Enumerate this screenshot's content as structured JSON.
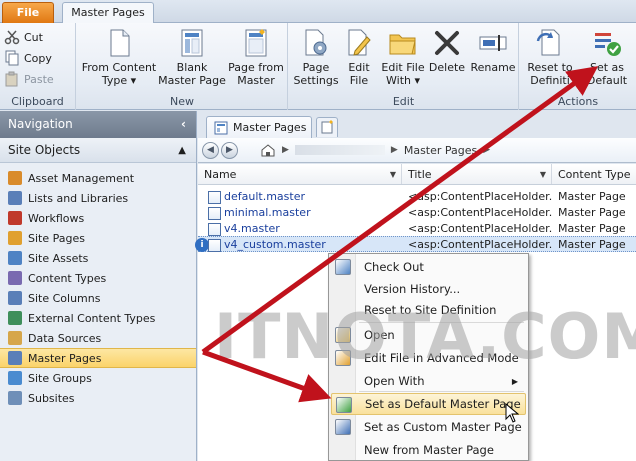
{
  "ribbon": {
    "tabs": [
      {
        "label": "File"
      },
      {
        "label": "Master Pages"
      }
    ],
    "clipboard": {
      "label": "Clipboard",
      "cut": "Cut",
      "copy": "Copy",
      "paste": "Paste"
    },
    "new_group": {
      "label": "New",
      "from_content_type": [
        "From Content",
        "Type ▾"
      ],
      "blank_master": [
        "Blank",
        "Master Page"
      ],
      "page_from_master": [
        "Page from",
        "Master"
      ]
    },
    "edit_group": {
      "label": "Edit",
      "page_settings": [
        "Page",
        "Settings"
      ],
      "edit_file": [
        "Edit",
        "File"
      ],
      "edit_file_with": [
        "Edit File",
        "With ▾"
      ],
      "delete": "Delete",
      "rename": "Rename"
    },
    "actions_group": {
      "label": "Actions",
      "reset": [
        "Reset to",
        "Definiti"
      ],
      "set_default": [
        "Set as",
        "Default"
      ]
    }
  },
  "navigation": {
    "title": "Navigation",
    "section": "Site Objects",
    "items": [
      {
        "label": "Asset Management",
        "icon": "asset-icon",
        "color": "#d98b2b"
      },
      {
        "label": "Lists and Libraries",
        "icon": "list-icon",
        "color": "#5a7fb8"
      },
      {
        "label": "Workflows",
        "icon": "workflow-icon",
        "color": "#c0392b"
      },
      {
        "label": "Site Pages",
        "icon": "pages-icon",
        "color": "#e0a030"
      },
      {
        "label": "Site Assets",
        "icon": "assets-icon",
        "color": "#4f83c4"
      },
      {
        "label": "Content Types",
        "icon": "content-types-icon",
        "color": "#7a6ab0"
      },
      {
        "label": "Site Columns",
        "icon": "columns-icon",
        "color": "#5a7fb8"
      },
      {
        "label": "External Content Types",
        "icon": "external-icon",
        "color": "#3f8f5b"
      },
      {
        "label": "Data Sources",
        "icon": "data-sources-icon",
        "color": "#d6a64a"
      },
      {
        "label": "Master Pages",
        "icon": "master-pages-icon",
        "color": "#5a7fb8",
        "selected": true
      },
      {
        "label": "Site Groups",
        "icon": "groups-icon",
        "color": "#4a8bd0"
      },
      {
        "label": "Subsites",
        "icon": "subsites-icon",
        "color": "#6f8fb8"
      }
    ]
  },
  "document": {
    "tab_label": "Master Pages",
    "breadcrumb": "Master Pages",
    "columns": [
      "Name",
      "Title",
      "Content Type"
    ],
    "rows": [
      {
        "name": "default.master",
        "title": "<asp:ContentPlaceHolder...",
        "type": "Master Page"
      },
      {
        "name": "minimal.master",
        "title": "<asp:ContentPlaceHolder...",
        "type": "Master Page"
      },
      {
        "name": "v4.master",
        "title": "<asp:ContentPlaceHolder...",
        "type": "Master Page"
      },
      {
        "name": "v4_custom.master",
        "title": "<asp:ContentPlaceHolder...",
        "type": "Master Page",
        "highlight": true
      }
    ]
  },
  "context_menu": {
    "items": [
      {
        "label": "Check Out",
        "icon": "check-out-icon"
      },
      {
        "label": "Version History...",
        "icon": ""
      },
      {
        "label": "Reset to Site Definition",
        "icon": ""
      },
      {
        "label": "Open",
        "icon": "open-icon"
      },
      {
        "label": "Edit File in Advanced Mode",
        "icon": "edit-icon"
      },
      {
        "label": "Open With",
        "icon": "",
        "submenu": true
      },
      {
        "label": "Set as Default Master Page",
        "icon": "set-default-icon",
        "hover": true
      },
      {
        "label": "Set as Custom Master Page",
        "icon": "set-custom-icon"
      },
      {
        "label": "New from Master Page",
        "icon": ""
      }
    ]
  },
  "watermark": "ITNOTA.COM",
  "colors": {
    "arrow": "#c0121c",
    "file_tab": "#e07812",
    "selection": "#fbd36a"
  }
}
